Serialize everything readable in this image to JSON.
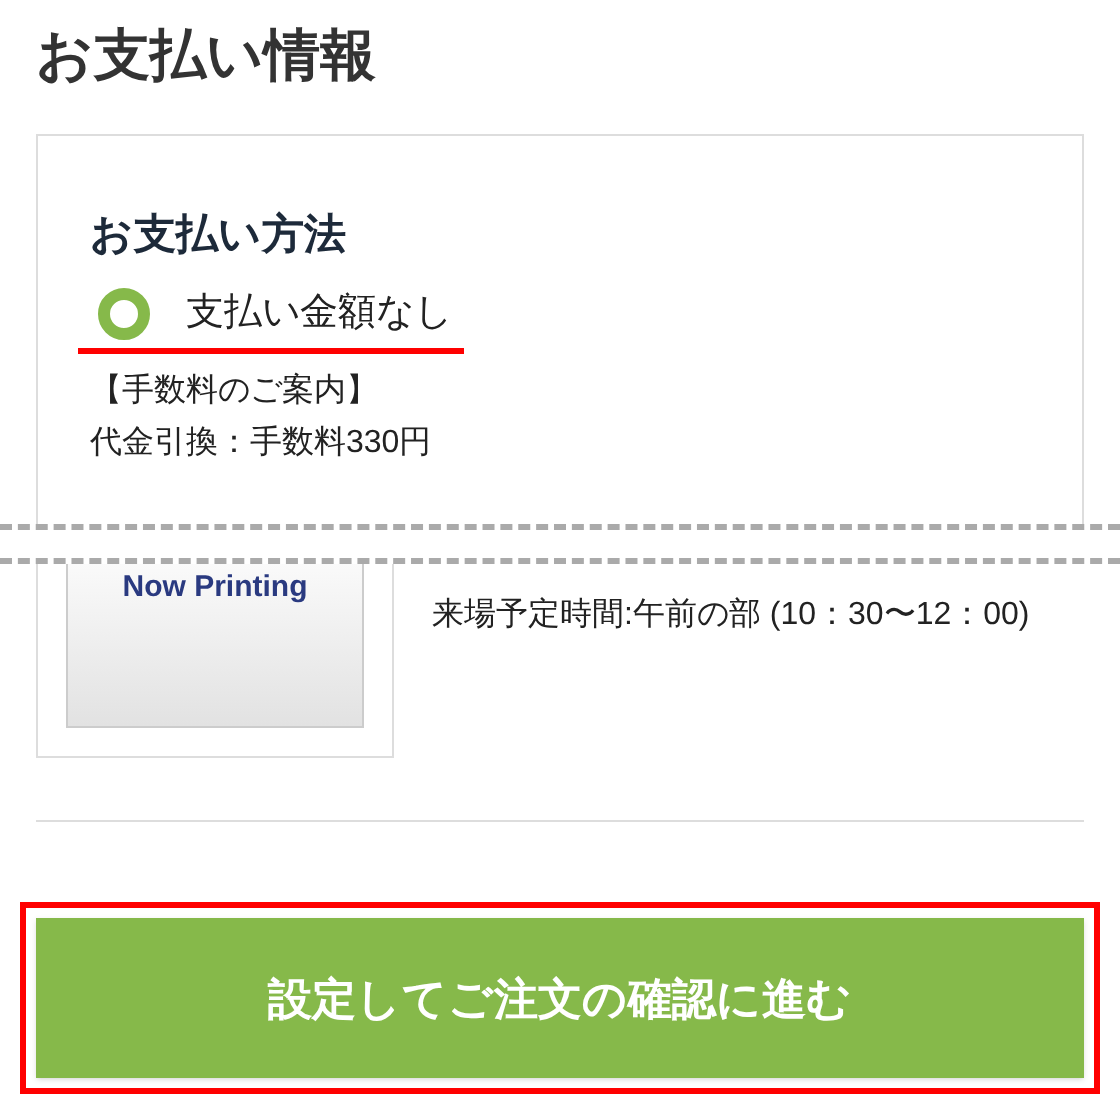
{
  "page_title": "お支払い情報",
  "payment_method": {
    "heading": "お支払い方法",
    "options": [
      {
        "label": "支払い金額なし",
        "selected": true
      }
    ],
    "fee_notice": [
      "【手数料のご案内】",
      "代金引換：手数料330円"
    ]
  },
  "product": {
    "image_text": "Now Printing",
    "details": [
      "来場予定時間:午前の部 (10：30〜12：00)"
    ]
  },
  "submit_button": "設定してご注文の確認に進む"
}
